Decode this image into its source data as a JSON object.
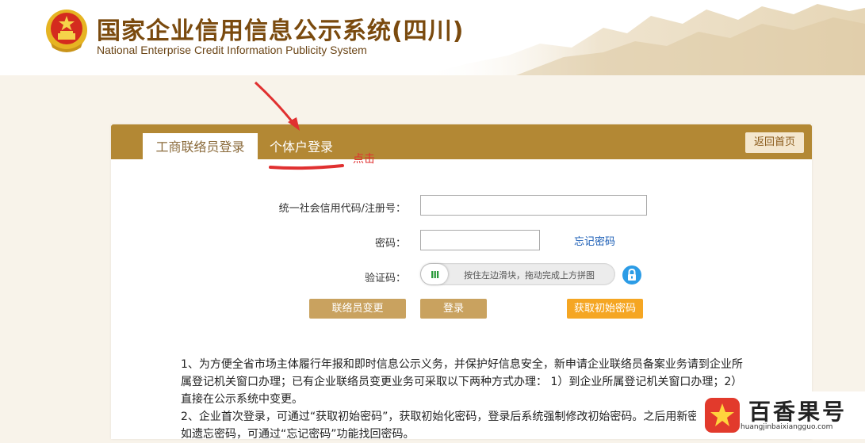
{
  "header": {
    "title_cn": "国家企业信用信息公示系统(四川)",
    "title_en": "National Enterprise Credit Information Publicity System"
  },
  "tabs": {
    "liaison_login": "工商联络员登录",
    "individual_login": "个体户登录"
  },
  "back_home": "返回首页",
  "form": {
    "code_label": "统一社会信用代码/注册号：",
    "password_label": "密码：",
    "forgot_password": "忘记密码",
    "captcha_label": "验证码：",
    "slider_hint": "按住左边滑块，拖动完成上方拼图",
    "slider_knob": "III"
  },
  "buttons": {
    "change_liaison": "联络员变更",
    "login": "登录",
    "get_initial_password": "获取初始密码"
  },
  "notice": [
    "1、为方便全省市场主体履行年报和即时信息公示义务，并保护好信息安全，新申请企业联络员备案业务请到企业所属登记机关窗口办理；已有企业联络员变更业务可采取以下两种方式办理： 1）到企业所属登记机关窗口办理；2）直接在公示系统中变更。",
    "2、企业首次登录，可通过“获取初始密码”，获取初始化密码，登录后系统强制修改初始密码。之后用新密码登录。如遗忘密码，可通过“忘记密码”功能找回密码。"
  ],
  "annotation": "点击",
  "watermark": {
    "name": "百香果号",
    "url": "huangjinbaixiangguo.com"
  },
  "colors": {
    "header_bar": "#b38834",
    "accent_orange": "#f5a623",
    "button_gold": "#c9a25f",
    "link_blue": "#1a5db5",
    "annotation_red": "#e03030"
  }
}
